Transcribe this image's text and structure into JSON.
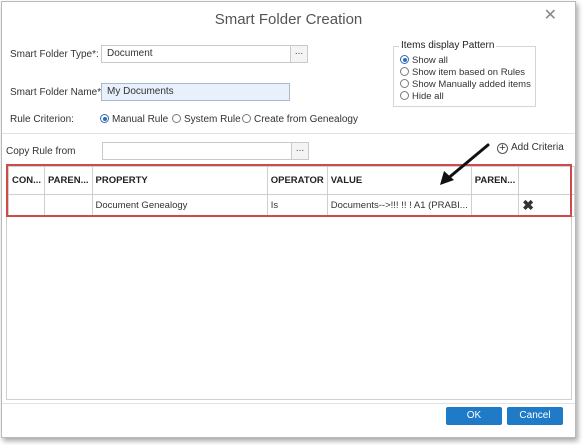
{
  "dialog": {
    "title": "Smart Folder Creation"
  },
  "form": {
    "type_label": "Smart Folder Type*:",
    "type_value": "Document",
    "name_label": "Smart Folder Name*:",
    "name_value": "My Documents",
    "rule_label": "Rule Criterion:",
    "rule_options": [
      "Manual Rule",
      "System Rule",
      "Create from Genealogy"
    ],
    "rule_selected": "Manual Rule",
    "copy_label": "Copy Rule from",
    "copy_value": "",
    "browse_label": "..."
  },
  "pattern": {
    "title": "Items display Pattern",
    "options": [
      "Show all",
      "Show item based on Rules",
      "Show Manually added items",
      "Hide all"
    ],
    "selected": "Show all"
  },
  "add_criteria": {
    "label": "Add Criteria",
    "icon": "plus-circle-icon"
  },
  "grid": {
    "columns": [
      "CON...",
      "PAREN...",
      "PROPERTY",
      "OPERATOR",
      "VALUE",
      "PAREN...",
      ""
    ],
    "rows": [
      {
        "con": "",
        "paren_open": "",
        "property": "Document Genealogy",
        "operator": "Is",
        "value": "Documents-->!!! !! ! A1 (PRABI...",
        "paren_close": "",
        "action_icon": "delete-x-icon"
      }
    ]
  },
  "highlight_color": "#d04a4a",
  "footer": {
    "ok_label": "OK",
    "cancel_label": "Cancel",
    "button_color": "#1f7bc7"
  }
}
